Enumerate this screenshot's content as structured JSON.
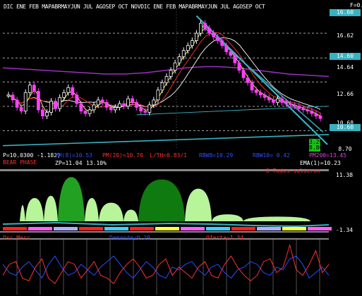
{
  "chart_data": {
    "type": "line",
    "month_labels_text": "DIC  ENE    FEB MAPABRMAYJUN JUL   AGOSEP OCT  NOVDIC ENE   FEB MAPABRMAYJUN JUL   AGOSEP OCT",
    "f_label": "F=0.0",
    "price_axis": [
      "16.60",
      "16.62",
      "14.60",
      "14.64",
      "12.66",
      "10.68",
      "10.60",
      "3.29",
      "8.80",
      "8.70"
    ],
    "price_ylim": [
      7.2,
      18.6
    ],
    "colors": {
      "background": "#000000",
      "candle_up": "#ffffff",
      "candle_down": "#ff40ff",
      "ma_fast": "#ffff50",
      "ma_mid": "#ff3030",
      "ma_slow": "#ffffff",
      "ma_long": "#9b30c0",
      "trend_cyan": "#38b2c0",
      "grid": "#ffffff",
      "osc_dark": "#0f7a0f",
      "osc_mid": "#22a022",
      "osc_light": "#b8f59a",
      "demand": "#2a4cff",
      "supply": "#ff3030",
      "axis_bar": "#888888"
    },
    "prices": [
      11.6,
      11.2,
      10.6,
      10.3,
      11.8,
      12.4,
      11.9,
      10.4,
      9.9,
      10.2,
      11.1,
      10.5,
      11.4,
      11.8,
      12.2,
      11.6,
      10.9,
      10.3,
      10.1,
      10.4,
      10.8,
      11.2,
      11.0,
      10.6,
      10.4,
      10.6,
      10.9,
      10.7,
      11.3,
      11.0,
      10.6,
      10.3,
      10.2,
      10.8,
      11.2,
      12.0,
      12.6,
      13.1,
      13.6,
      14.2,
      14.7,
      15.2,
      15.6,
      16.0,
      16.6,
      17.4,
      17.0,
      16.6,
      16.3,
      16.0,
      15.6,
      15.1,
      14.8,
      14.2,
      13.6,
      13.0,
      12.6,
      12.0,
      11.8,
      11.6,
      11.4,
      11.2,
      11.0,
      11.3,
      11.0,
      10.9,
      10.8,
      10.7,
      10.5,
      10.4,
      10.3,
      10.1,
      9.9,
      9.7
    ],
    "ma_long": [
      13.8,
      13.75,
      13.7,
      13.65,
      13.6,
      13.55,
      13.5,
      13.45,
      13.4,
      13.35,
      13.3,
      13.3,
      13.3,
      13.35,
      13.4,
      13.5,
      13.6,
      13.7,
      13.8,
      13.85,
      13.9,
      13.9,
      13.85,
      13.8,
      13.7,
      13.6,
      13.5,
      13.4,
      13.3,
      13.25,
      13.2,
      13.15,
      13.1
    ],
    "stats": {
      "price": "P=10.0300  -1.182)",
      "mm": "MM(8)=10.53",
      "pm": "PM(20)=10.70",
      "lth": "L/TH=0.83/1",
      "rbw8": "RBW8=10.29",
      "rbw10": "RBW10= 0.42",
      "pm_right": "PM200=13.45",
      "phase": "BEAR PHASE",
      "zp": "ZP=11.04",
      "pct": "13.10%",
      "ema": "EMA(1)=10.23"
    },
    "oscillator": {
      "exit_label": "-3 Todos salieron",
      "max_label": "11.38",
      "min_label": "-1.34",
      "ylim": [
        -1.34,
        11.38
      ]
    },
    "demand": {
      "osc_label": "Osc Merc",
      "demand_label": "Demanda=0.29",
      "supply_label": "Oferta=1.34",
      "demand_values": [
        0.55,
        0.4,
        0.35,
        0.5,
        0.6,
        0.45,
        0.3,
        0.55,
        0.7,
        0.5,
        0.35,
        0.4,
        0.55,
        0.45,
        0.35,
        0.5,
        0.6,
        0.7,
        0.55,
        0.4,
        0.3,
        0.45,
        0.6,
        0.5,
        0.35,
        0.3,
        0.5,
        0.45,
        0.55,
        0.6,
        0.45,
        0.35,
        0.5,
        0.55,
        0.4,
        0.3,
        0.45,
        0.5,
        0.6,
        0.55,
        0.4,
        0.35,
        0.5,
        0.45,
        0.65,
        0.7,
        0.55,
        0.3,
        0.4,
        0.5,
        0.35
      ],
      "supply_values": [
        0.35,
        0.55,
        0.6,
        0.3,
        0.25,
        0.5,
        0.65,
        0.3,
        0.2,
        0.4,
        0.6,
        0.55,
        0.3,
        0.45,
        0.6,
        0.35,
        0.3,
        0.2,
        0.4,
        0.55,
        0.65,
        0.5,
        0.3,
        0.35,
        0.55,
        0.65,
        0.35,
        0.5,
        0.4,
        0.3,
        0.5,
        0.6,
        0.35,
        0.3,
        0.55,
        0.7,
        0.5,
        0.35,
        0.25,
        0.35,
        0.6,
        0.65,
        0.4,
        0.5,
        0.9,
        0.45,
        0.35,
        0.55,
        0.8,
        0.4,
        0.55
      ]
    }
  }
}
